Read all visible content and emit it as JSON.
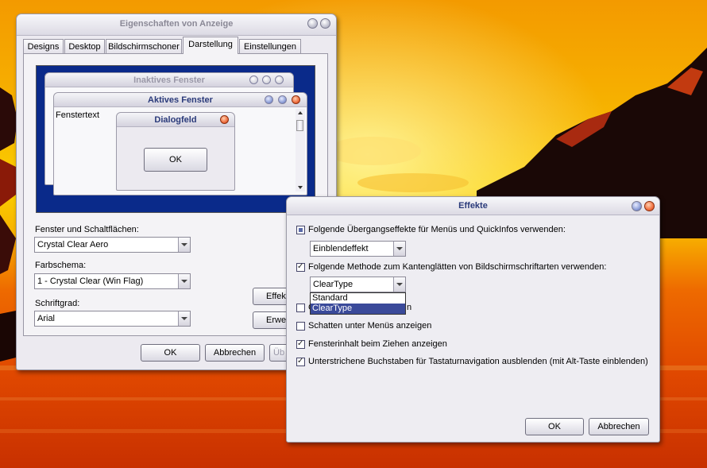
{
  "display_properties": {
    "title": "Eigenschaften von Anzeige",
    "tabs": [
      "Designs",
      "Desktop",
      "Bildschirmschoner",
      "Darstellung",
      "Einstellungen"
    ],
    "active_tab": "Darstellung",
    "preview": {
      "inactive_title": "Inaktives Fenster",
      "active_title": "Aktives Fenster",
      "window_text": "Fenstertext",
      "dialog_title": "Dialogfeld",
      "dialog_ok": "OK"
    },
    "windows_buttons_label": "Fenster und Schaltflächen:",
    "windows_buttons_value": "Crystal Clear Aero",
    "color_scheme_label": "Farbschema:",
    "color_scheme_value": "1 - Crystal Clear (Win Flag)",
    "font_size_label": "Schriftgrad:",
    "font_size_value": "Arial",
    "effects_button": "Effek",
    "advanced_button": "Erwe",
    "ok_button": "OK",
    "cancel_button": "Abbrechen",
    "apply_button": "Üb"
  },
  "effects_dialog": {
    "title": "Effekte",
    "opt1_label": "Folgende Übergangseffekte für Menüs und QuickInfos verwenden:",
    "opt1_state": "partial",
    "opt1_select": "Einblendeffekt",
    "opt2_label": "Folgende Methode zum Kantenglätten von Bildschirmschriftarten verwenden:",
    "opt2_state": "checked",
    "opt2_select": "ClearType",
    "dropdown_options": [
      "Standard",
      "ClearType"
    ],
    "dropdown_selected": "ClearType",
    "opt3_fragment_left": "G",
    "opt3_fragment_right": "n",
    "opt4_label": "Schatten unter Menüs anzeigen",
    "opt5_label": "Fensterinhalt beim Ziehen anzeigen",
    "opt6_label": "Unterstrichene Buchstaben für Tastaturnavigation ausblenden (mit Alt-Taste einblenden)",
    "ok_button": "OK",
    "cancel_button": "Abbrechen"
  },
  "colors": {
    "preview_desktop": "#0a2a8a",
    "selection": "#3a4a9a",
    "sky_top": "#f6a800",
    "sea": "#e04a00"
  },
  "icons": [
    "minimize-icon",
    "maximize-icon",
    "close-icon",
    "scroll-up-icon",
    "scroll-down-icon",
    "dropdown-arrow-icon",
    "checkmark-icon"
  ]
}
